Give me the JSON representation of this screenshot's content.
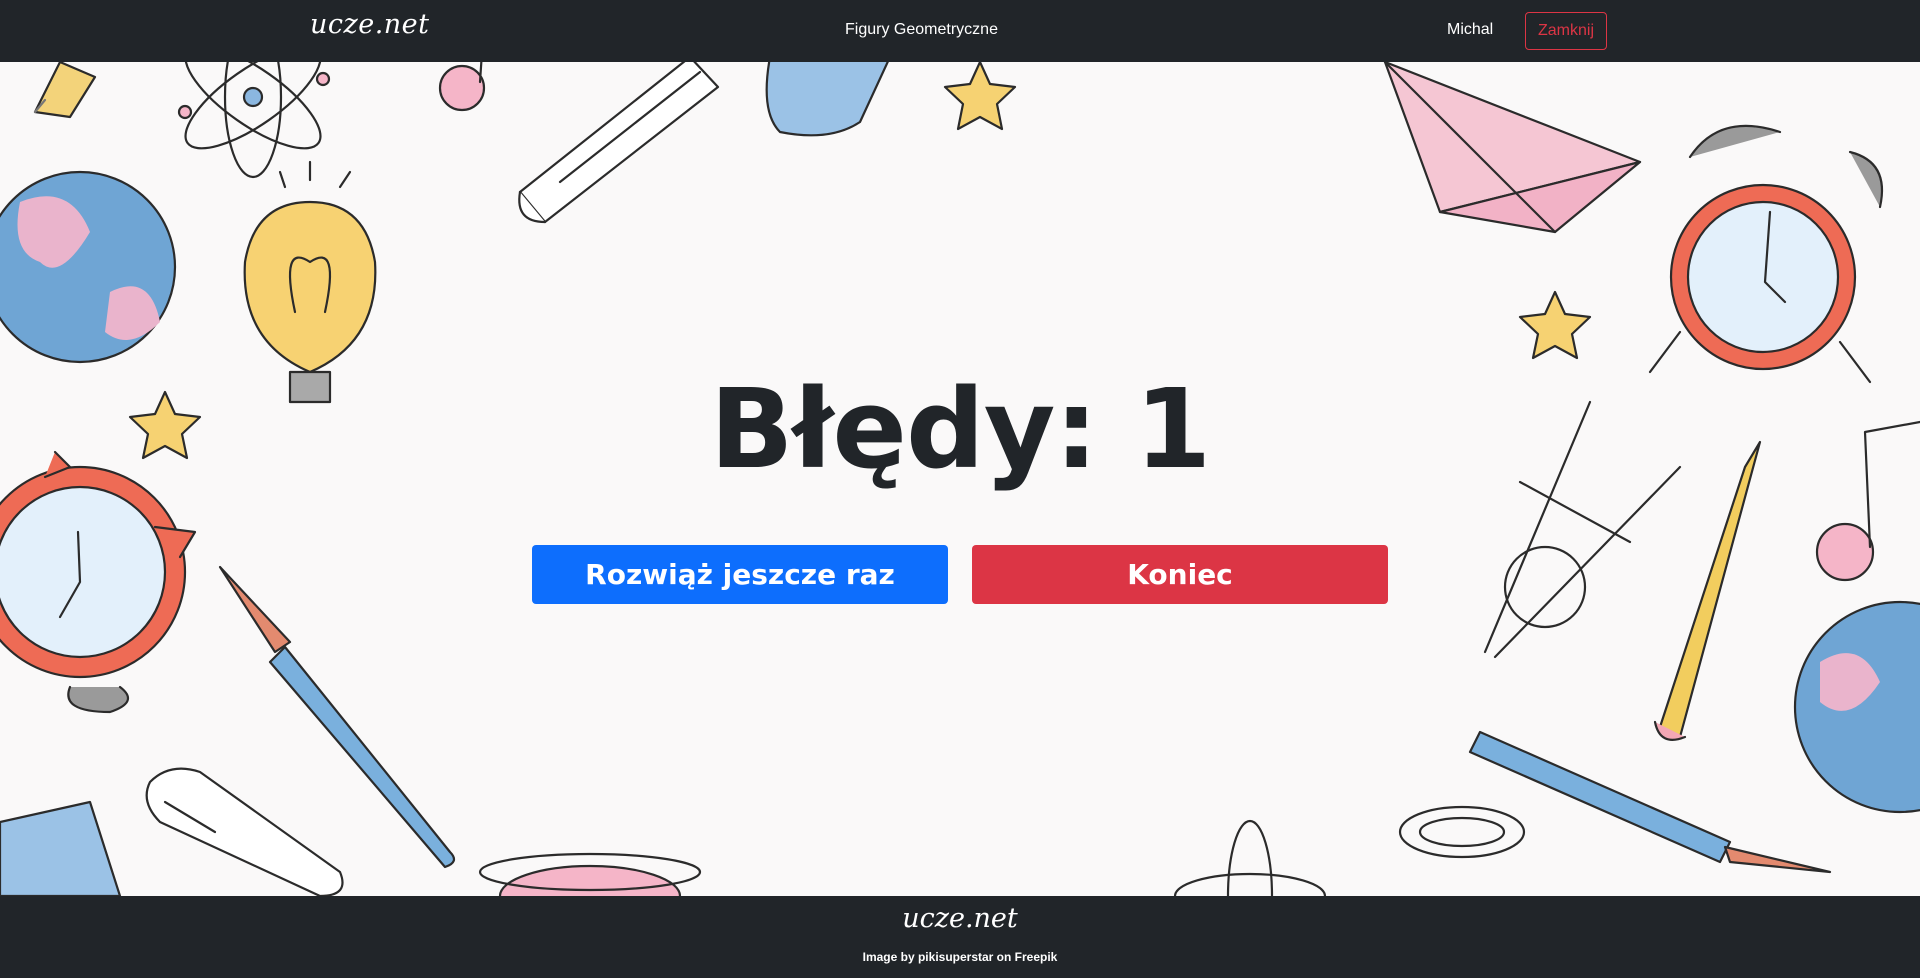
{
  "navbar": {
    "brand": "ucze.net",
    "title": "Figury Geometryczne",
    "user": "Michal",
    "close_label": "Zamknij"
  },
  "main": {
    "result": "Błędy: 1",
    "retry_label": "Rozwiąż jeszcze raz",
    "end_label": "Koniec"
  },
  "footer": {
    "logo": "ucze.net",
    "credit": "Image by pikisuperstar on Freepik"
  },
  "colors": {
    "primary": "#0d6efd",
    "danger": "#dc3545",
    "dark": "#212529",
    "background": "#faf9f9"
  }
}
